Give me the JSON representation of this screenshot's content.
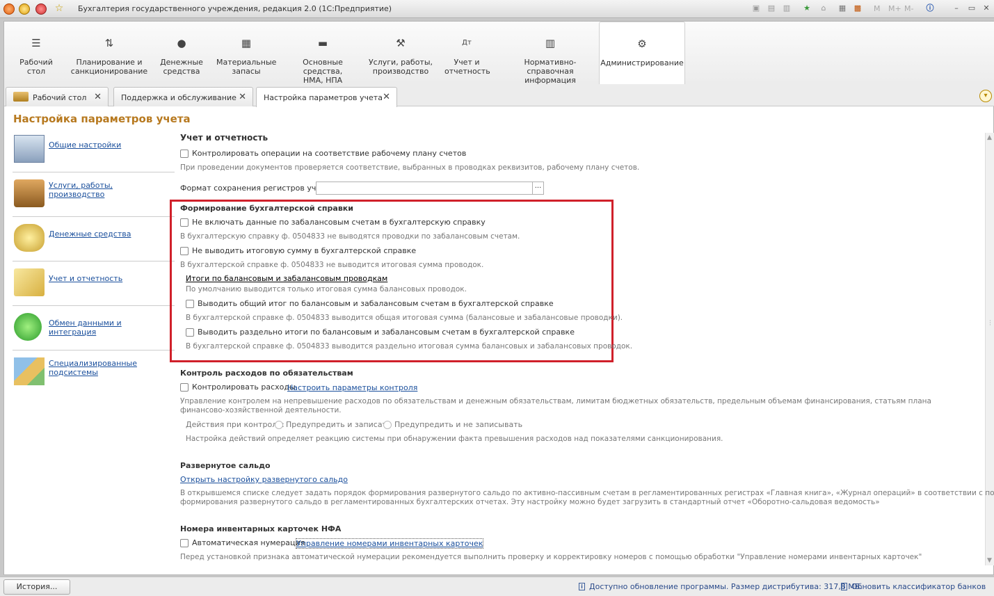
{
  "window": {
    "title": "Бухгалтерия государственного учреждения, редакция 2.0  (1С:Предприятие)",
    "mem_buttons": [
      "M",
      "M+",
      "M-"
    ]
  },
  "sections": [
    {
      "label": "Рабочий\nстол",
      "icon": "menu-icon"
    },
    {
      "label": "Планирование и\nсанкционирование",
      "icon": "planning-icon"
    },
    {
      "label": "Денежные\nсредства",
      "icon": "money-icon"
    },
    {
      "label": "Материальные\nзапасы",
      "icon": "grid-icon"
    },
    {
      "label": "Основные средства,\nНМА, НПА",
      "icon": "truck-icon"
    },
    {
      "label": "Услуги, работы,\nпроизводство",
      "icon": "tools-icon"
    },
    {
      "label": "Учет и\nотчетность",
      "icon": "debit-credit-icon"
    },
    {
      "label": "Нормативно-справочная\nинформация",
      "icon": "books-icon"
    },
    {
      "label": "Администрирование",
      "icon": "gear-icon"
    }
  ],
  "tabs": [
    {
      "label": "Рабочий стол"
    },
    {
      "label": "Поддержка и обслуживание"
    },
    {
      "label": "Настройка параметров учета"
    }
  ],
  "page": {
    "title": "Настройка параметров учета"
  },
  "nav": [
    {
      "label": "Общие настройки"
    },
    {
      "label": "Услуги, работы, производство"
    },
    {
      "label": "Денежные средства"
    },
    {
      "label": "Учет и отчетность"
    },
    {
      "label": "Обмен данными и интеграция"
    },
    {
      "label": "Специализированные подсистемы"
    }
  ],
  "accounting": {
    "heading": "Учет и отчетность",
    "check_plan_label": "Контролировать операции на соответствие рабочему плану счетов",
    "check_plan_note": "При проведении документов проверяется соответствие, выбранных в проводках реквизитов, рабочему плану счетов.",
    "format_label": "Формат сохранения регистров учета:",
    "format_value": "",
    "format_btn": "..."
  },
  "reference": {
    "heading": "Формирование бухгалтерской справки",
    "offbalance_label": "Не включать данные по забалансовым счетам в бухгалтерскую справку",
    "offbalance_note": "В бухгалтерскую справку ф. 0504833 не выводятся проводки по забалансовым счетам.",
    "total_label": "Не выводить итоговую сумму в бухгалтерской справке",
    "total_note": "В бухгалтерской справке ф. 0504833 не выводится итоговая сумма проводок.",
    "totals_link": "Итоги по балансовым и забалансовым проводкам",
    "totals_note": "По умолчанию выводится только итоговая сумма балансовых проводок.",
    "common_total_label": "Выводить общий итог по балансовым и забалансовым счетам в бухгалтерской справке",
    "common_total_note": "В бухгалтерской справке ф. 0504833 выводится общая итоговая сумма (балансовые и забалансовые проводки).",
    "separate_total_label": "Выводить раздельно итоги по балансовым и забалансовым счетам в бухгалтерской справке",
    "separate_total_note": "В бухгалтерской справке ф. 0504833 выводится раздельно итоговая сумма балансовых и забалансовых проводок."
  },
  "expenses": {
    "heading": "Контроль расходов по обязательствам",
    "control_label": "Контролировать расходы",
    "control_link": "Настроить параметры контроля",
    "note_line1": "Управление контролем на непревышение расходов по обязательствам и денежным обязательствам, лимитам бюджетных обязательств, предельным объемам финансирования, статьям плана",
    "note_line2": "финансово-хозяйственной деятельности.",
    "actions_label": "Действия при контроле:",
    "action1": "Предупредить и записать",
    "action2": "Предупредить и не записывать",
    "actions_note": "Настройка действий определяет реакцию системы при обнаружении факта превышения расходов над показателями санкционирования."
  },
  "saldo": {
    "heading": "Развернутое сальдо",
    "link": "Открыть настройку развернутого сальдо",
    "note_line1": "В открывшемся списке следует задать порядок формирования развернутого сальдо по активно-пассивным счетам в регламентированных регистрах «Главная книга», «Журнал операций» в соответствии с порядком",
    "note_line2": "формирования развернутого сальдо в регламентированных бухгалтерских отчетах. Эту настройку можно будет загрузить в стандартный отчет «Оборотно-сальдовая ведомость»"
  },
  "inventory": {
    "heading": "Номера инвентарных карточек НФА",
    "auto_label": "Автоматическая нумерация",
    "link": "Управление номерами инвентарных карточек",
    "note": "Перед установкой признака автоматической нумерации рекомендуется выполнить проверку и корректировку номеров с помощью обработки \"Управление номерами инвентарных карточек\""
  },
  "status": {
    "history": "История...",
    "update": "Доступно обновление программы. Размер дистрибутива: 317,8 МБ.",
    "banks": "Обновить классификатор банков"
  },
  "colors": {
    "highlight": "#d0202a",
    "title": "#b7791f",
    "link": "#1a4f9c"
  }
}
